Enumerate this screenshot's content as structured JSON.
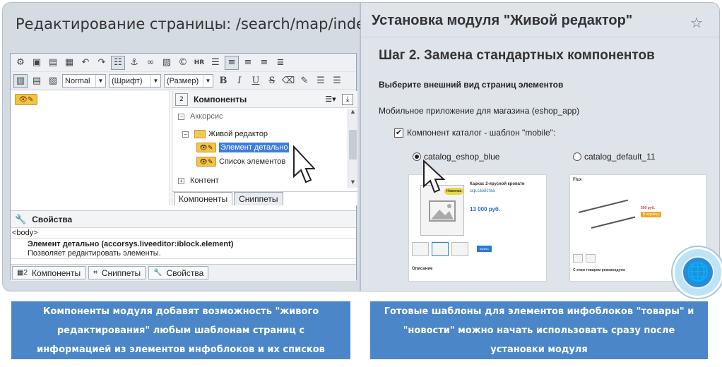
{
  "left": {
    "title": "Редактирование страницы: /search/map/index.php",
    "toolbar": {
      "format_value": "Normal",
      "font_value": "(Шрифт)",
      "size_value": "(Размер)",
      "bold": "B",
      "italic": "I",
      "underline": "U",
      "strike": "S",
      "hr": "HR"
    },
    "components_panel": {
      "title": "Компоненты",
      "tree": {
        "group1": "Аккорсис",
        "folder": "Живой редактор",
        "item_selected": "Элемент детально",
        "item2": "Список элементов",
        "group2": "Контент"
      },
      "tabs": [
        "Компоненты",
        "Сниппеты"
      ]
    },
    "properties": {
      "title": "Свойства",
      "tag": "<body>",
      "name": "Элемент детально (accorsys.liveeditor:iblock.element)",
      "description": "Позволяет редактировать элементы."
    },
    "bottom_tabs": [
      "Компоненты",
      "Сниппеты",
      "Свойства"
    ]
  },
  "right": {
    "title": "Установка модуля \"Живой редактор\"",
    "step": "Шаг 2. Замена стандартных компонентов",
    "choose": "Выберите внешний вид страниц элементов",
    "app": "Мобильное приложение для магазина (eshop_app)",
    "checkbox_label": "Компонент каталог - шаблон \"mobile\":",
    "radio1": "catalog_eshop_blue",
    "radio2": "catalog_default_11",
    "thumb1": {
      "product": "Каркас 2-ярусной кровати",
      "link": "скр.свойства",
      "price": "13 000 руб.",
      "badge": "Новинка",
      "buy": "Купить",
      "section": "Описание"
    },
    "thumb2": {
      "brand": "Flux",
      "price": "500 руб.",
      "buy": "В корзину",
      "section": "С этим товаром рекомендуем"
    }
  },
  "captions": {
    "left": [
      "Компоненты модуля добавят возможность \"живого",
      "редактирования\" любым шаблонам страниц с",
      "информацией из элементов инфоблоков и их списков"
    ],
    "right": [
      "Готовые шаблоны для элементов инфоблоков \"товары\" и",
      "\"новости\" можно начать использовать сразу после",
      "установки модуля"
    ]
  },
  "colors": {
    "caption_bg": "#4a86c8",
    "selection": "#3c7de0",
    "component_icon": "#f6c343"
  }
}
